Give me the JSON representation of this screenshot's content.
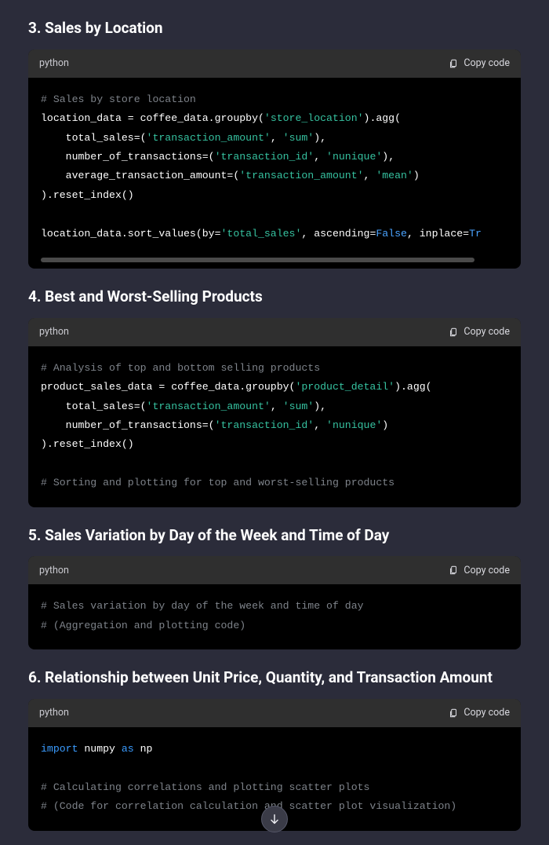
{
  "copy_label": "Copy code",
  "sections": [
    {
      "heading": "3. Sales by Location",
      "lang": "python",
      "tokens": [
        {
          "c": "comment",
          "t": "# Sales by store location"
        },
        {
          "c": "nl"
        },
        {
          "c": "plain",
          "t": "location_data = coffee_data.groupby("
        },
        {
          "c": "str",
          "t": "'store_location'"
        },
        {
          "c": "plain",
          "t": ").agg("
        },
        {
          "c": "nl"
        },
        {
          "c": "plain",
          "t": "    total_sales=("
        },
        {
          "c": "str",
          "t": "'transaction_amount'"
        },
        {
          "c": "plain",
          "t": ", "
        },
        {
          "c": "str",
          "t": "'sum'"
        },
        {
          "c": "plain",
          "t": "),"
        },
        {
          "c": "nl"
        },
        {
          "c": "plain",
          "t": "    number_of_transactions=("
        },
        {
          "c": "str",
          "t": "'transaction_id'"
        },
        {
          "c": "plain",
          "t": ", "
        },
        {
          "c": "str",
          "t": "'nunique'"
        },
        {
          "c": "plain",
          "t": "),"
        },
        {
          "c": "nl"
        },
        {
          "c": "plain",
          "t": "    average_transaction_amount=("
        },
        {
          "c": "str",
          "t": "'transaction_amount'"
        },
        {
          "c": "plain",
          "t": ", "
        },
        {
          "c": "str",
          "t": "'mean'"
        },
        {
          "c": "plain",
          "t": ")"
        },
        {
          "c": "nl"
        },
        {
          "c": "plain",
          "t": ").reset_index()"
        },
        {
          "c": "nl"
        },
        {
          "c": "nl"
        },
        {
          "c": "plain",
          "t": "location_data.sort_values(by="
        },
        {
          "c": "str",
          "t": "'total_sales'"
        },
        {
          "c": "plain",
          "t": ", ascending="
        },
        {
          "c": "bool",
          "t": "False"
        },
        {
          "c": "plain",
          "t": ", inplace="
        },
        {
          "c": "bool",
          "t": "Tr"
        }
      ],
      "overflow": true
    },
    {
      "heading": "4. Best and Worst-Selling Products",
      "lang": "python",
      "tokens": [
        {
          "c": "comment",
          "t": "# Analysis of top and bottom selling products"
        },
        {
          "c": "nl"
        },
        {
          "c": "plain",
          "t": "product_sales_data = coffee_data.groupby("
        },
        {
          "c": "str",
          "t": "'product_detail'"
        },
        {
          "c": "plain",
          "t": ").agg("
        },
        {
          "c": "nl"
        },
        {
          "c": "plain",
          "t": "    total_sales=("
        },
        {
          "c": "str",
          "t": "'transaction_amount'"
        },
        {
          "c": "plain",
          "t": ", "
        },
        {
          "c": "str",
          "t": "'sum'"
        },
        {
          "c": "plain",
          "t": "),"
        },
        {
          "c": "nl"
        },
        {
          "c": "plain",
          "t": "    number_of_transactions=("
        },
        {
          "c": "str",
          "t": "'transaction_id'"
        },
        {
          "c": "plain",
          "t": ", "
        },
        {
          "c": "str",
          "t": "'nunique'"
        },
        {
          "c": "plain",
          "t": ")"
        },
        {
          "c": "nl"
        },
        {
          "c": "plain",
          "t": ").reset_index()"
        },
        {
          "c": "nl"
        },
        {
          "c": "nl"
        },
        {
          "c": "comment",
          "t": "# Sorting and plotting for top and worst-selling products"
        }
      ],
      "overflow": false
    },
    {
      "heading": "5. Sales Variation by Day of the Week and Time of Day",
      "lang": "python",
      "tokens": [
        {
          "c": "comment",
          "t": "# Sales variation by day of the week and time of day"
        },
        {
          "c": "nl"
        },
        {
          "c": "comment",
          "t": "# (Aggregation and plotting code)"
        }
      ],
      "overflow": false
    },
    {
      "heading": "6. Relationship between Unit Price, Quantity, and Transaction Amount",
      "lang": "python",
      "tokens": [
        {
          "c": "kw",
          "t": "import"
        },
        {
          "c": "plain",
          "t": " numpy "
        },
        {
          "c": "kw",
          "t": "as"
        },
        {
          "c": "plain",
          "t": " np"
        },
        {
          "c": "nl"
        },
        {
          "c": "nl"
        },
        {
          "c": "comment",
          "t": "# Calculating correlations and plotting scatter plots"
        },
        {
          "c": "nl"
        },
        {
          "c": "comment",
          "t": "# (Code for correlation calculation and scatter plot visualization)"
        }
      ],
      "overflow": false
    }
  ]
}
